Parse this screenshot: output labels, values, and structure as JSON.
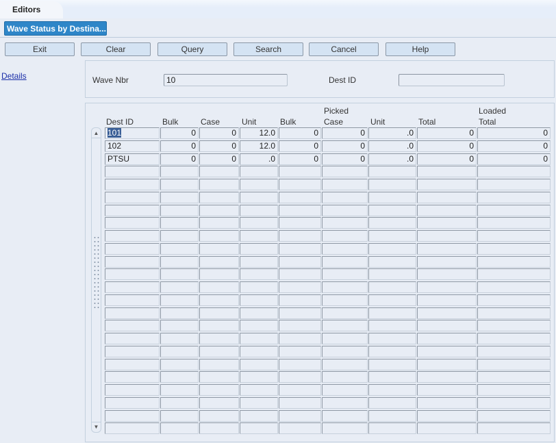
{
  "window": {
    "tab_label": "Editors",
    "screen_title": "Wave Status by Destina..."
  },
  "toolbar": {
    "buttons": [
      "Exit",
      "Clear",
      "Query",
      "Search",
      "Cancel",
      "Help"
    ]
  },
  "sidebar": {
    "details_link": "Details"
  },
  "filter": {
    "wave_nbr_label": "Wave Nbr",
    "wave_nbr_value": "10",
    "dest_id_label": "Dest ID",
    "dest_id_value": ""
  },
  "grid": {
    "group_headers": {
      "picked": "Picked",
      "loaded": "Loaded"
    },
    "columns": [
      "Dest ID",
      "Bulk",
      "Case",
      "Unit",
      "Bulk",
      "Case",
      "Unit",
      "Total",
      "Total"
    ],
    "rows": [
      [
        "101",
        "0",
        "0",
        "12.0",
        "0",
        "0",
        ".0",
        "0",
        "0"
      ],
      [
        "102",
        "0",
        "0",
        "12.0",
        "0",
        "0",
        ".0",
        "0",
        "0"
      ],
      [
        "PTSU",
        "0",
        "0",
        ".0",
        "0",
        "0",
        ".0",
        "0",
        "0"
      ]
    ],
    "visible_row_count": 24,
    "selected_row": 0
  },
  "icons": {
    "scroll_up": "▲",
    "scroll_down": "▼"
  }
}
